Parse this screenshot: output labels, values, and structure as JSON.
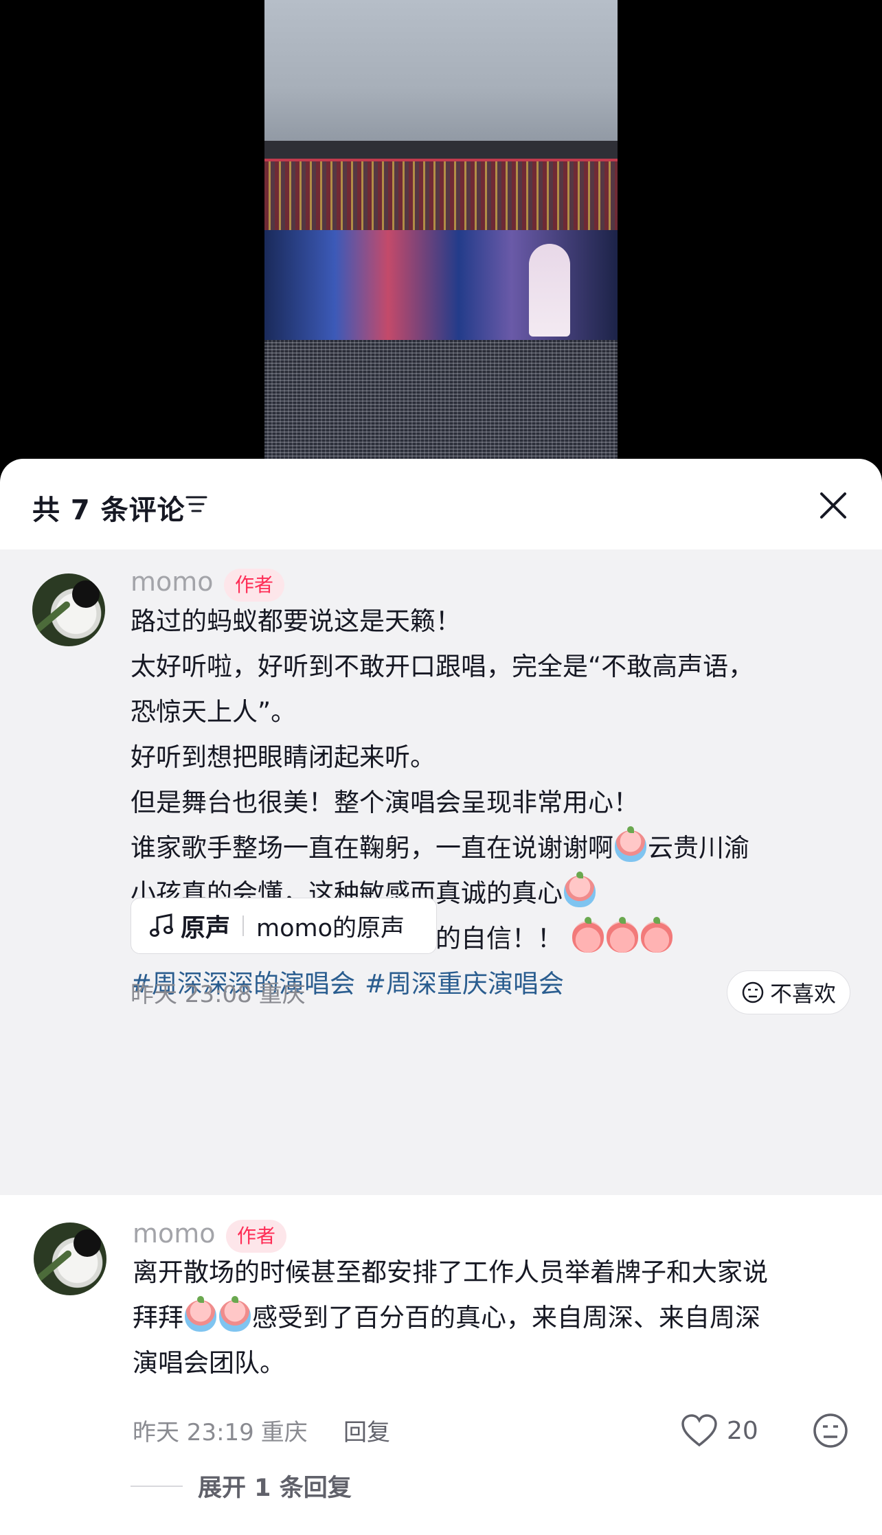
{
  "sheet": {
    "title": "共 7 条评论",
    "filter_icon": "filter-lines-icon",
    "close_icon": "close-icon"
  },
  "comments": [
    {
      "username": "momo",
      "badge": "作者",
      "lines": [
        "路过的蚂蚁都要说这是天籁！",
        "太好听啦，好听到不敢开口跟唱，完全是“不敢高声语，",
        "恐惊天上人”。",
        "好听到想把眼睛闭起来听。",
        "但是舞台也很美！整个演唱会呈现非常用心！",
        "谁家歌手整场一直在鞠躬，一直在说谢谢啊",
        "云贵川渝",
        "小孩真的会懂，这种敏感而真诚的真心",
        "周深值得！！你值得百分百的自信！！"
      ],
      "hashtags": [
        "#周深深深的演唱会",
        "#周深重庆演唱会"
      ],
      "music": {
        "tag": "原声",
        "name": "momo的原声",
        "icon": "music-note-icon"
      },
      "time": "昨天 23:08",
      "location": "重庆",
      "dislike_label": "不喜欢",
      "emoji_icon": "crying-peach-emoji-icon"
    },
    {
      "username": "momo",
      "badge": "作者",
      "lines": [
        "离开散场的时候甚至都安排了工作人员举着牌子和大家说",
        "拜拜",
        "感受到了百分百的真心，来自周深、来自周深",
        "演唱会团队。"
      ],
      "time": "昨天 23:19",
      "location": "重庆",
      "reply_label": "回复",
      "like_count": "20",
      "expand_label": "展开 1 条回复"
    }
  ]
}
